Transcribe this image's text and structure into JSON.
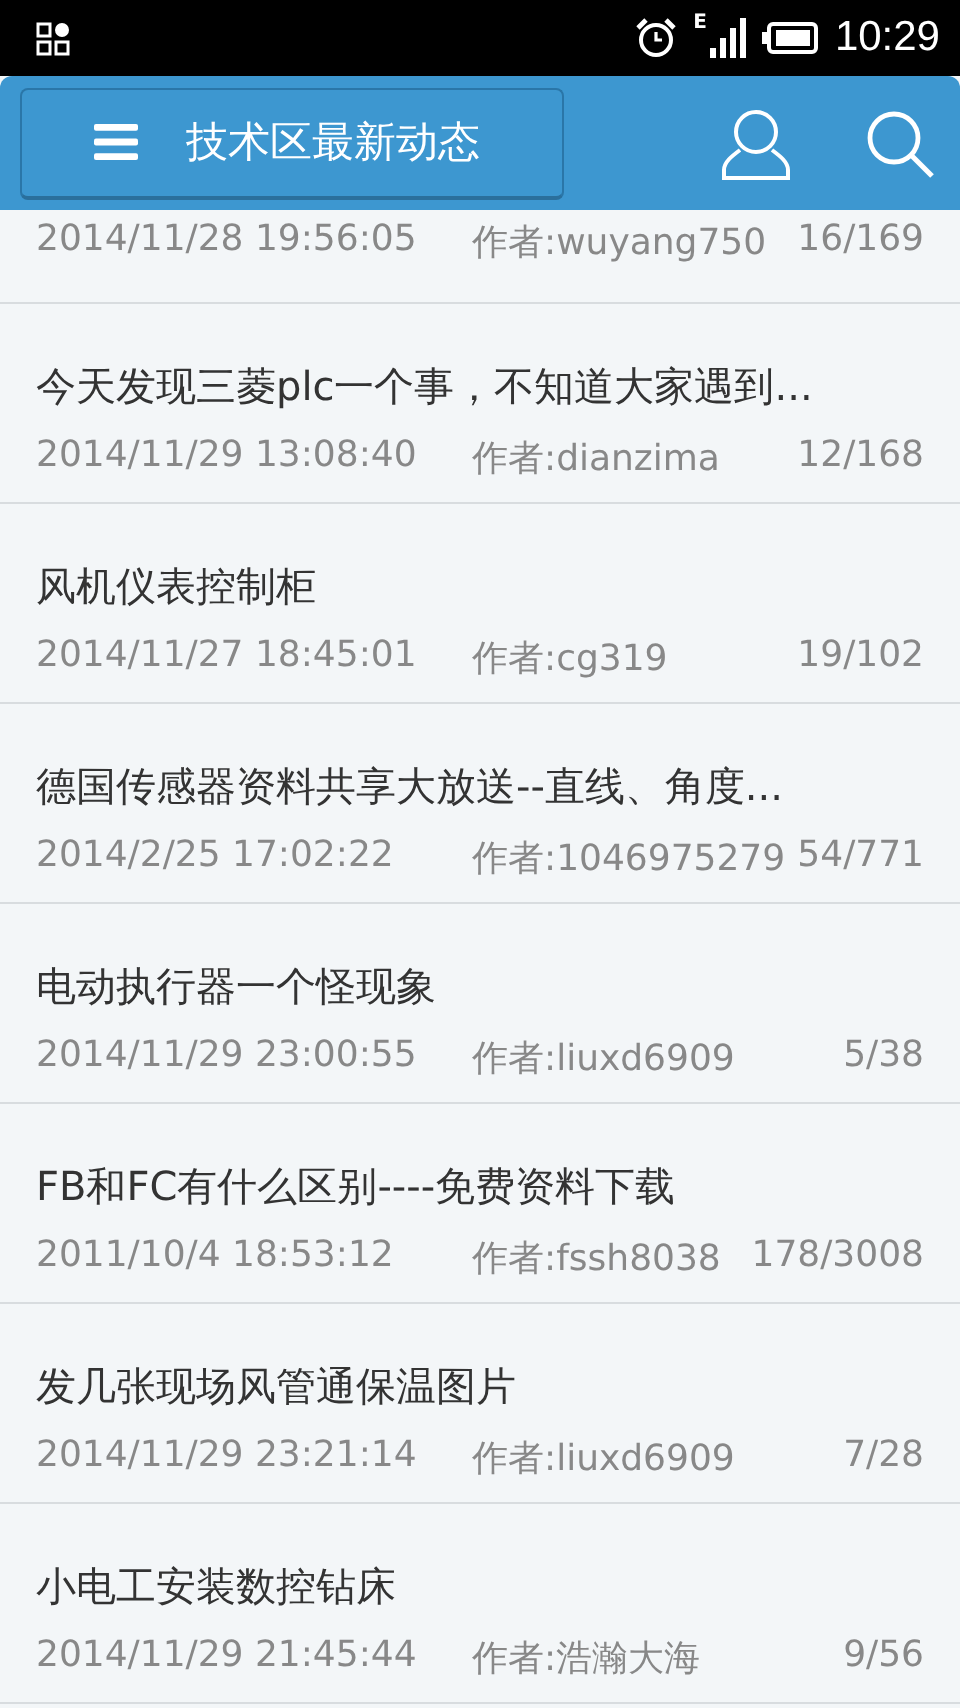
{
  "status_bar": {
    "time": "10:29",
    "network": "E"
  },
  "header": {
    "title": "技术区最新动态"
  },
  "posts": [
    {
      "date": "2014/11/28 19:56:05",
      "author": "作者:wuyang750",
      "count": "16/169"
    },
    {
      "title": "今天发现三菱plc一个事，不知道大家遇到...",
      "date": "2014/11/29 13:08:40",
      "author": "作者:dianzima",
      "count": "12/168"
    },
    {
      "title": "风机仪表控制柜",
      "date": "2014/11/27 18:45:01",
      "author": "作者:cg319",
      "count": "19/102"
    },
    {
      "title": "德国传感器资料共享大放送--直线、角度...",
      "date": "2014/2/25 17:02:22",
      "author": "作者:1046975279",
      "count": "54/771"
    },
    {
      "title": "电动执行器一个怪现象",
      "date": "2014/11/29 23:00:55",
      "author": "作者:liuxd6909",
      "count": "5/38"
    },
    {
      "title": "FB和FC有什么区别----免费资料下载",
      "date": "2011/10/4 18:53:12",
      "author": "作者:fssh8038",
      "count": "178/3008"
    },
    {
      "title": "发几张现场风管通保温图片",
      "date": "2014/11/29 23:21:14",
      "author": "作者:liuxd6909",
      "count": "7/28"
    },
    {
      "title": "小电工安装数控钻床",
      "date": "2014/11/29 21:45:44",
      "author": "作者:浩瀚大海",
      "count": "9/56"
    }
  ]
}
